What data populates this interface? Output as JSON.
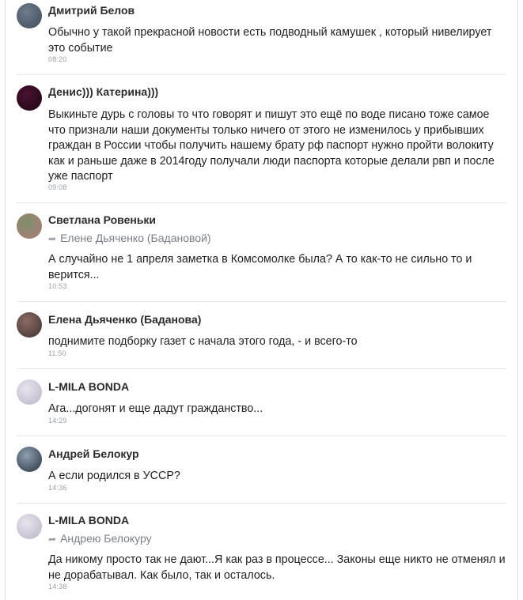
{
  "comments": [
    {
      "author": "Дмитрий Белов",
      "avatar_colors": [
        "#6f7d8c",
        "#3f4a56"
      ],
      "reply_to": "",
      "text": "Обычно у такой прекрасной новости есть подводный камушек , который нивелирует это событие",
      "time": "08:20"
    },
    {
      "author": "Денис))) Катерина)))",
      "avatar_colors": [
        "#4a1232",
        "#1d0612"
      ],
      "reply_to": "",
      "text": "Выкиньте дурь с головы то что говорят и пишут это ещё по воде писано тоже самое что признали наши документы только ничего от этого не изменилось у прибывших граждан в России чтобы получить нашему брату рф паспорт нужно пройти волокиту как и раньше даже в 2014году получали люди паспорта которые делали рвп и после уже паспорт",
      "time": "09:08"
    },
    {
      "author": "Светлана Ровеньки",
      "avatar_colors": [
        "#7d8f6a",
        "#b07a7a"
      ],
      "reply_to": "Елене Дьяченко (Бадановой)",
      "text": "А случайно не 1 апреля заметка в Комсомолке была? А то как-то не сильно то и верится...",
      "time": "10:53"
    },
    {
      "author": "Елена Дьяченко (Баданова)",
      "avatar_colors": [
        "#8b6b63",
        "#3c3131"
      ],
      "reply_to": "",
      "text": "поднимите подборку газет с начала этого года, - и всего-то",
      "time": "11:50"
    },
    {
      "author": "L-MILA BONDA",
      "avatar_colors": [
        "#e9e4ee",
        "#b9b3c4"
      ],
      "reply_to": "",
      "text": "Ага...догонят и еще дадут гражданство...",
      "time": "14:29"
    },
    {
      "author": "Андрей Белокур",
      "avatar_colors": [
        "#8fa0b2",
        "#27313c"
      ],
      "reply_to": "",
      "text": "А если родился в УССР?",
      "time": "14:36"
    },
    {
      "author": "L-MILA BONDA",
      "avatar_colors": [
        "#e9e4ee",
        "#b9b3c4"
      ],
      "reply_to": "Андрею Белокуру",
      "text": "Да никому просто так не дают...Я как раз в процессе... Законы еще никто не отменял и не дорабатывал. Как было, так и осталось.",
      "time": "14:38"
    }
  ]
}
